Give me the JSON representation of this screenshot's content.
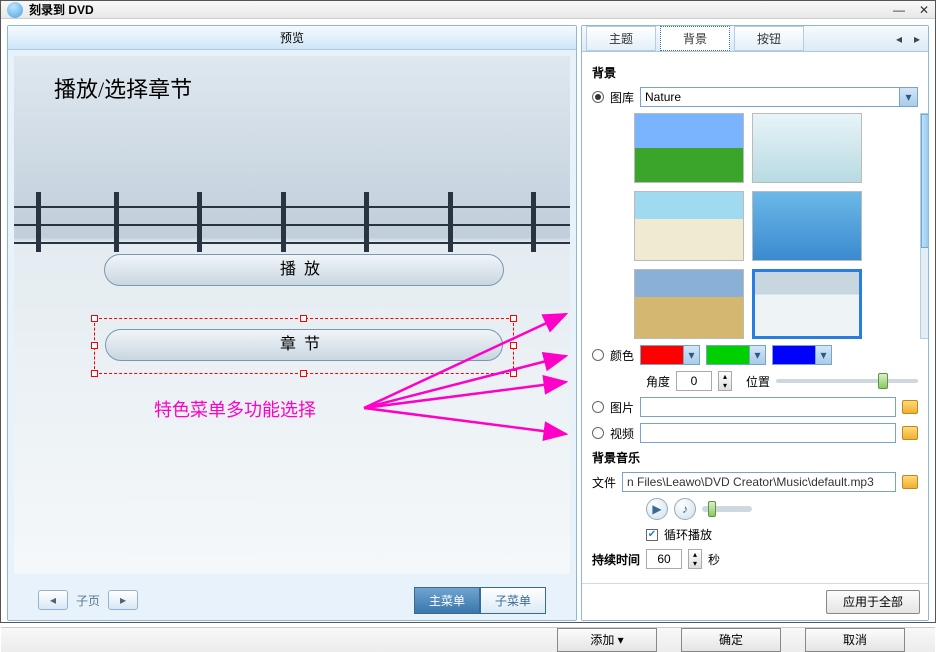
{
  "window": {
    "title": "刻录到 DVD"
  },
  "preview": {
    "header": "预览",
    "overlayTitle": "播放/选择章节",
    "playBtn": "播放",
    "chapterBtn": "章节",
    "annotation": "特色菜单多功能选择",
    "subPageLabel": "子页",
    "mainMenuTab": "主菜单",
    "subMenuTab": "子菜单"
  },
  "rightTabs": {
    "theme": "主题",
    "background": "背景",
    "button": "按钮"
  },
  "bg": {
    "sectionTitle": "背景",
    "galleryLabel": "图库",
    "galleryValue": "Nature",
    "colorLabel": "颜色",
    "angleLabel": "角度",
    "angleValue": "0",
    "posLabel": "位置",
    "imageLabel": "图片",
    "videoLabel": "视频",
    "musicTitle": "背景音乐",
    "fileLabel": "文件",
    "filePath": "n Files\\Leawo\\DVD Creator\\Music\\default.mp3",
    "loopLabel": "循环播放",
    "durationLabel": "持续时间",
    "durationValue": "60",
    "durationUnit": "秒",
    "colors": {
      "c1": "#ff0000",
      "c2": "#00d000",
      "c3": "#0000ff"
    },
    "posSlider": 0.72,
    "volSlider": 0.12
  },
  "actions": {
    "applyAll": "应用于全部",
    "add": "添加",
    "ok": "确定",
    "cancel": "取消"
  }
}
